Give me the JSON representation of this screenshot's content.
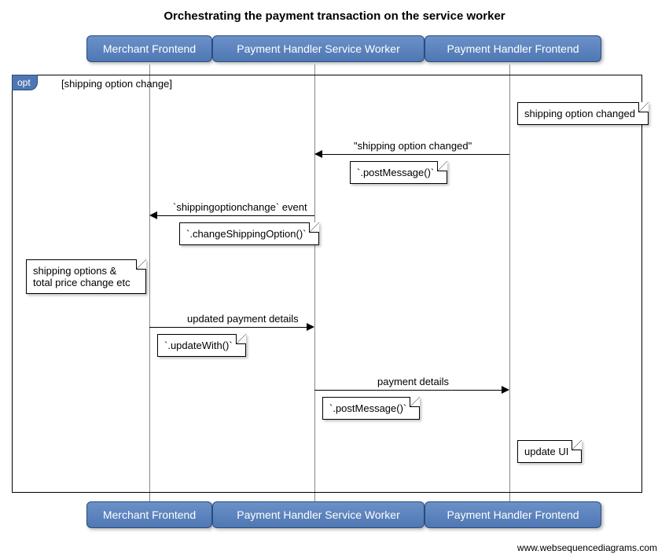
{
  "title": "Orchestrating the payment transaction on the service worker",
  "participants": {
    "merchant": "Merchant Frontend",
    "serviceworker": "Payment Handler Service Worker",
    "phfrontend": "Payment Handler Frontend"
  },
  "fragment": {
    "type": "opt",
    "guard": "[shipping option change]"
  },
  "notes": {
    "n1": "shipping option changed",
    "n2": "`.postMessage()`",
    "n3": "`.changeShippingOption()`",
    "n4_line1": "shipping options &",
    "n4_line2": "total price change etc",
    "n5": "`.updateWith()`",
    "n6": "`.postMessage()`",
    "n7": "update UI"
  },
  "messages": {
    "m1": "\"shipping option changed\"",
    "m2": "`shippingoptionchange` event",
    "m3": "updated payment details",
    "m4": "payment details"
  },
  "footer": "www.websequencediagrams.com",
  "chart_data": {
    "type": "sequence-diagram",
    "title": "Orchestrating the payment transaction on the service worker",
    "participants": [
      "Merchant Frontend",
      "Payment Handler Service Worker",
      "Payment Handler Frontend"
    ],
    "fragments": [
      {
        "type": "opt",
        "guard": "shipping option change",
        "steps": [
          {
            "type": "note",
            "over": "Payment Handler Frontend",
            "text": "shipping option changed"
          },
          {
            "type": "message",
            "from": "Payment Handler Frontend",
            "to": "Payment Handler Service Worker",
            "label": "\"shipping option changed\""
          },
          {
            "type": "note",
            "over": "Payment Handler Service Worker",
            "text": ".postMessage()"
          },
          {
            "type": "message",
            "from": "Payment Handler Service Worker",
            "to": "Merchant Frontend",
            "label": "`shippingoptionchange` event"
          },
          {
            "type": "note",
            "over": "Payment Handler Service Worker",
            "text": ".changeShippingOption()"
          },
          {
            "type": "note",
            "over": "Merchant Frontend",
            "text": "shipping options & total price change etc"
          },
          {
            "type": "message",
            "from": "Merchant Frontend",
            "to": "Payment Handler Service Worker",
            "label": "updated payment details"
          },
          {
            "type": "note",
            "over": "Merchant Frontend",
            "text": ".updateWith()"
          },
          {
            "type": "message",
            "from": "Payment Handler Service Worker",
            "to": "Payment Handler Frontend",
            "label": "payment details"
          },
          {
            "type": "note",
            "over": "Payment Handler Service Worker",
            "text": ".postMessage()"
          },
          {
            "type": "note",
            "over": "Payment Handler Frontend",
            "text": "update UI"
          }
        ]
      }
    ]
  }
}
